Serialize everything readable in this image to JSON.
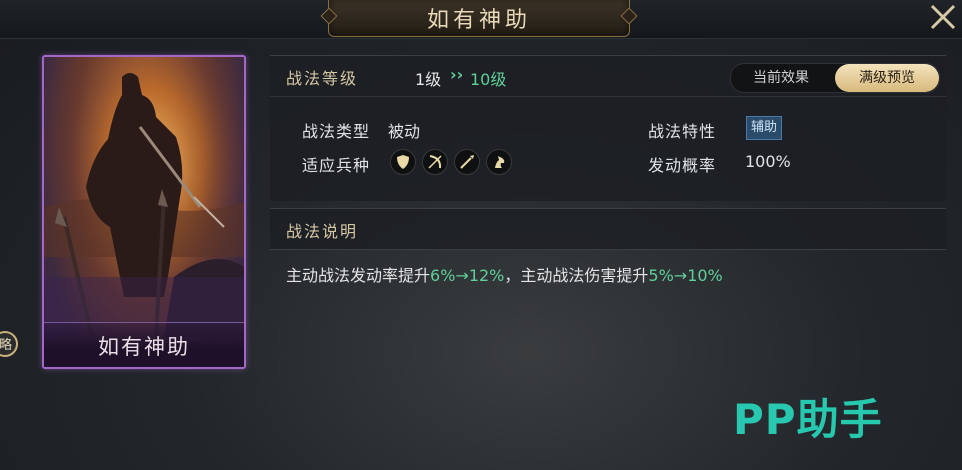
{
  "header": {
    "title": "如有神助",
    "close_icon": "close-icon"
  },
  "card": {
    "name": "如有神助",
    "side_badge": "略",
    "border_color": "#a267c7"
  },
  "level": {
    "label": "战法等级",
    "current": "1级",
    "arrow": "››",
    "max": "10级"
  },
  "toggle": {
    "current_effect": "当前效果",
    "max_preview": "满级预览",
    "selected": "满级预览"
  },
  "attributes": {
    "type_label": "战法类型",
    "type_value": "被动",
    "trait_label": "战法特性",
    "trait_value": "辅助",
    "troops_label": "适应兵种",
    "troops_icons": [
      "shield-icon",
      "bow-icon",
      "spear-icon",
      "horse-icon"
    ],
    "rate_label": "发动概率",
    "rate_value": "100%"
  },
  "description": {
    "title": "战法说明",
    "p1": "主动战法发动率提升",
    "v1_from": "6%",
    "arrow1": "→",
    "v1_to": "12%",
    "p2": "，主动战法伤害提升",
    "v2_from": "5%",
    "arrow2": "→",
    "v2_to": "10%"
  },
  "watermark": {
    "text": "PP助手"
  },
  "colors": {
    "accent_green": "#5fd09a",
    "gold": "#d7b97c",
    "watermark": "#27d1b6"
  }
}
